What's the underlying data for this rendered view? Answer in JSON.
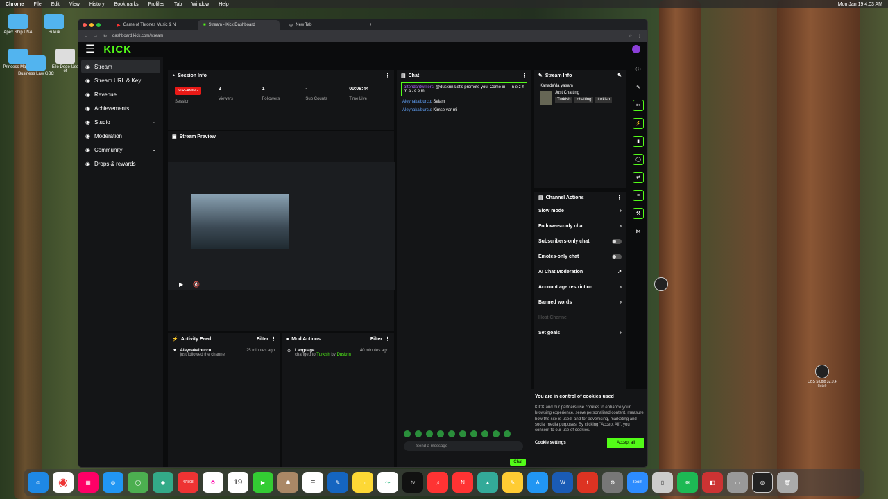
{
  "menubar": {
    "app": "Chrome",
    "items": [
      "File",
      "Edit",
      "View",
      "History",
      "Bookmarks",
      "Profiles",
      "Tab",
      "Window",
      "Help"
    ],
    "clock": "Mon Jan 19 4:03 AM"
  },
  "desktop_icons": [
    "Apex Ship USA",
    "Hukuk",
    "Princess Master",
    "Business Law GBC",
    "Elle Dege Use of"
  ],
  "tabs": [
    "Game of Thrones Music & N",
    "Stream - Kick Dashboard",
    "New Tab"
  ],
  "url": "dashboard.kick.com/stream",
  "logo": "KICK",
  "sidebar": [
    {
      "label": "Stream",
      "icon": "broadcast-icon"
    },
    {
      "label": "Stream URL & Key",
      "icon": "link-icon"
    },
    {
      "label": "Revenue",
      "icon": "money-icon"
    },
    {
      "label": "Achievements",
      "icon": "trophy-icon"
    },
    {
      "label": "Studio",
      "icon": "studio-icon",
      "chev": "⌄"
    },
    {
      "label": "Moderation",
      "icon": "shield-icon"
    },
    {
      "label": "Community",
      "icon": "people-icon",
      "chev": "⌄"
    },
    {
      "label": "Drops & rewards",
      "icon": "gift-icon"
    }
  ],
  "session": {
    "title": "Session Info",
    "status": "STREAMING",
    "labels": [
      "Session",
      "Viewers",
      "Followers",
      "Sub Counts",
      "Time Live"
    ],
    "values": [
      "",
      "2",
      "1",
      "-",
      "00:08:44"
    ]
  },
  "preview": {
    "title": "Stream Preview"
  },
  "activity": {
    "title": "Activity Feed",
    "filter": "Filter",
    "user": "Aleynakalburcu",
    "action": "just followed the channel",
    "time": "25 minutes ago"
  },
  "mod": {
    "title": "Mod Actions",
    "filter": "Filter",
    "label": "Language",
    "action": "changed to",
    "value": "Turkish",
    "by": "by",
    "who": "Duskrin",
    "time": "40 minutes ago"
  },
  "chat": {
    "title": "Chat",
    "messages": [
      {
        "user": "attendantwriters",
        "text": "@duskrin Let's promote you. Come in — n e z h m a . c o m"
      },
      {
        "user": "Aleynakalburcu",
        "text": "Selam"
      },
      {
        "user": "Aleynakalburcu",
        "text": "Kimse var mi"
      }
    ],
    "placeholder": "Send a message",
    "send": "Chat"
  },
  "streaminfo": {
    "title": "Stream Info",
    "name": "Kanada'da yasam",
    "category": "Just Chatting",
    "tags": [
      "Turkish",
      "chatting",
      "turkish"
    ]
  },
  "actions": {
    "title": "Channel Actions",
    "items": [
      {
        "label": "Slow mode",
        "kind": "chev"
      },
      {
        "label": "Followers-only chat",
        "kind": "chev"
      },
      {
        "label": "Subscribers-only chat",
        "kind": "toggle"
      },
      {
        "label": "Emotes-only chat",
        "kind": "toggle"
      },
      {
        "label": "AI Chat Moderation",
        "kind": "ext"
      },
      {
        "label": "Account age restriction",
        "kind": "chev"
      },
      {
        "label": "Banned words",
        "kind": "chev"
      },
      {
        "label": "Host Channel",
        "kind": "none"
      },
      {
        "label": "Set goals",
        "kind": "chev"
      }
    ]
  },
  "cookie": {
    "title": "You are in control of cookies used",
    "body": "KICK and our partners use cookies to enhance your browsing experience, serve personalised content, measure how the site is used, and for advertising, marketing and social media purposes. By clicking \"Accept All\", you consent to our use of cookies.",
    "settings": "Cookie settings",
    "accept": "Accept all"
  },
  "obs": "OBS Studio 32.0.4 (Intel)",
  "dock": {
    "calendar_day": "19",
    "mail_badge": "47,808",
    "zoom": "zoom"
  }
}
